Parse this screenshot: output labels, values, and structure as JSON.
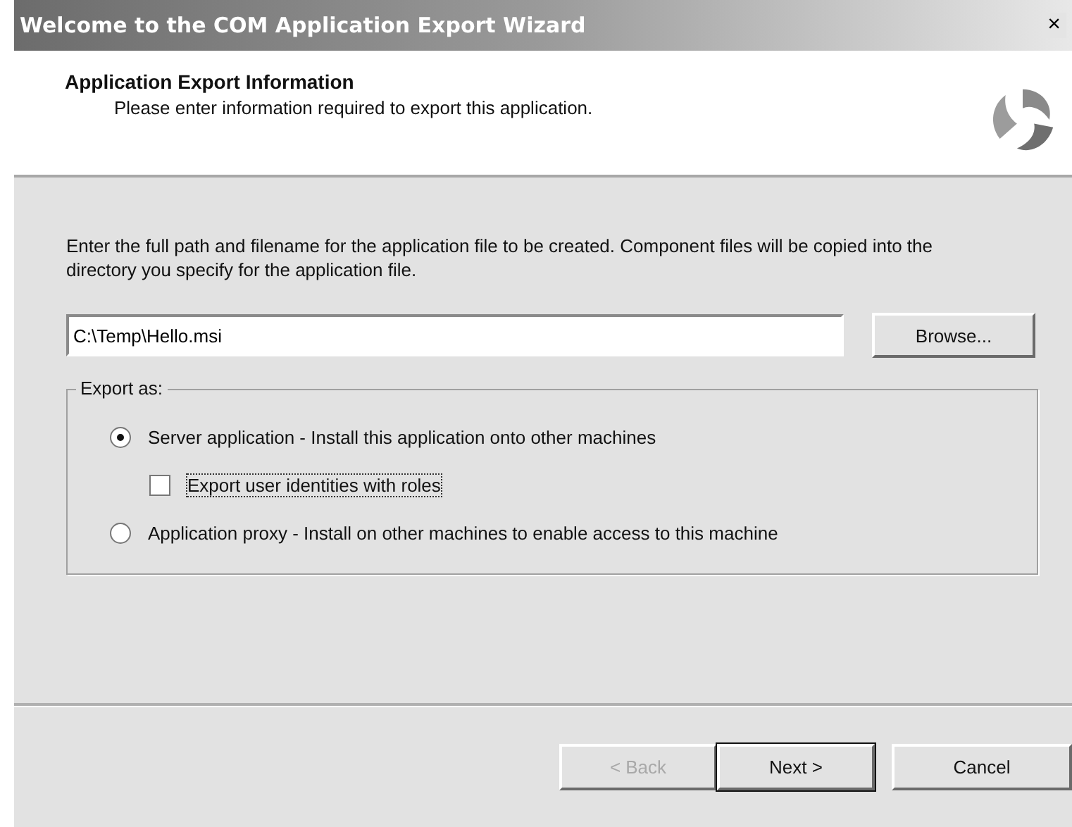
{
  "window": {
    "title": "Welcome to the COM Application Export Wizard",
    "close": "×"
  },
  "header": {
    "title": "Application Export Information",
    "subtitle": "Please enter information required to export this application."
  },
  "instructions": "Enter the full path and filename for the application file to be created.  Component files will be copied into the directory you specify for the application file.",
  "path_field": {
    "value": "C:\\Temp\\Hello.msi"
  },
  "browse_button": "Browse...",
  "export_group": {
    "label": "Export as:",
    "options": [
      {
        "kind": "radio",
        "label": "Server application - Install this application onto other machines",
        "selected": true
      },
      {
        "kind": "checkbox",
        "label": "Export user identities with roles",
        "checked": false
      },
      {
        "kind": "radio",
        "label": "Application proxy - Install on other machines to enable access to this machine",
        "selected": false
      }
    ]
  },
  "buttons": [
    {
      "label": "< Back",
      "disabled": true,
      "default": false
    },
    {
      "label": "Next >",
      "disabled": false,
      "default": true
    },
    {
      "label": "Cancel",
      "disabled": false,
      "default": false
    }
  ]
}
